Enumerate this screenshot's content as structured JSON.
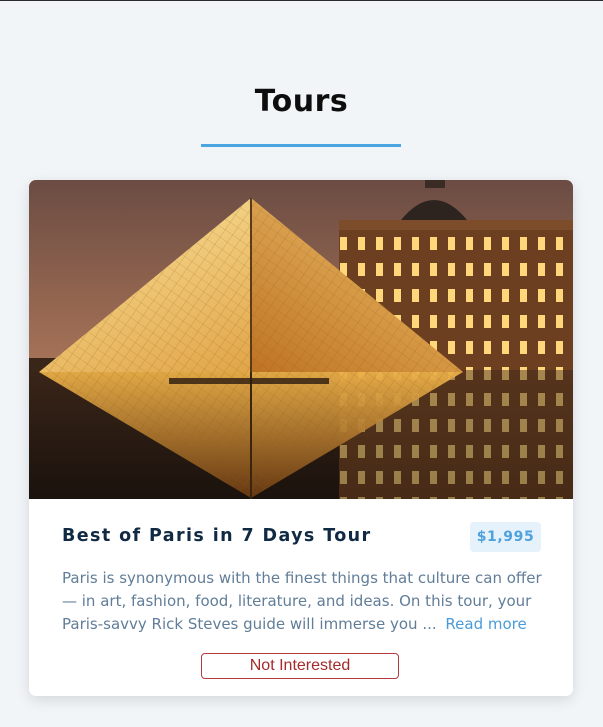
{
  "page": {
    "title": "Tours"
  },
  "tour": {
    "name": "Best of Paris in 7 Days Tour",
    "price": "$1,995",
    "description": "Paris is synonymous with the finest things that culture can offer — in art, fashion, food, literature, and ideas. On this tour, your Paris-savvy Rick Steves guide will immerse you ...",
    "read_more_label": "Read more",
    "not_interested_label": "Not Interested",
    "image_icon": "louvre-pyramid-photo"
  },
  "colors": {
    "accent": "#49a6e0",
    "price_bg": "#e6f2fb",
    "price_text": "#4ea1dd",
    "danger": "#a52a2a"
  }
}
